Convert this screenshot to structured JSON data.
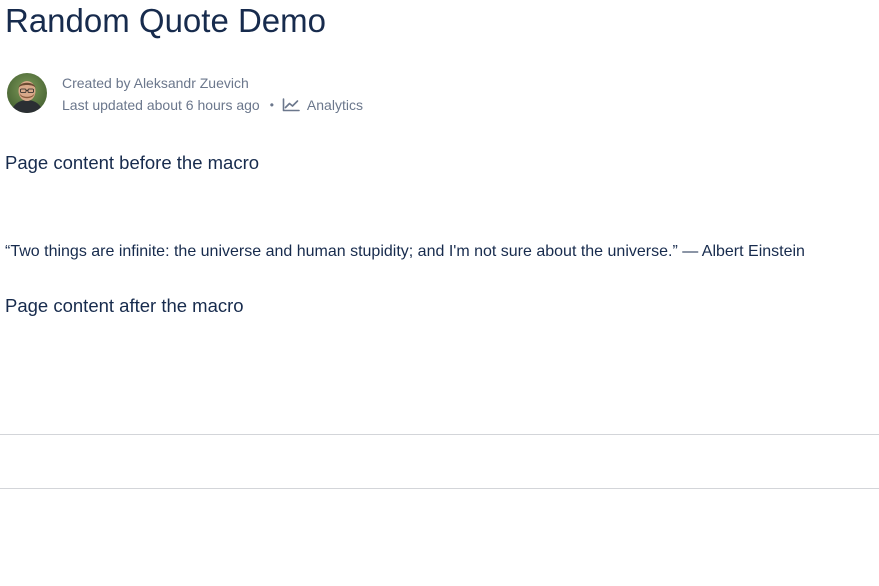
{
  "page": {
    "title": "Random Quote Demo"
  },
  "byline": {
    "created_by": "Created by Aleksandr Zuevich",
    "last_updated": "Last updated about 6 hours ago",
    "separator": "•",
    "analytics_label": "Analytics",
    "analytics_icon": "line-chart-icon",
    "avatar_icon": "user-avatar-photo"
  },
  "content": {
    "before_macro": "Page content before the macro",
    "quote": "“Two things are infinite: the universe and human stupidity; and I'm not sure about the universe.” — Albert Einstein",
    "after_macro": "Page content after the macro"
  },
  "colors": {
    "text_primary": "#172b4d",
    "text_secondary": "#6b778c",
    "divider": "#d3d5d9"
  }
}
